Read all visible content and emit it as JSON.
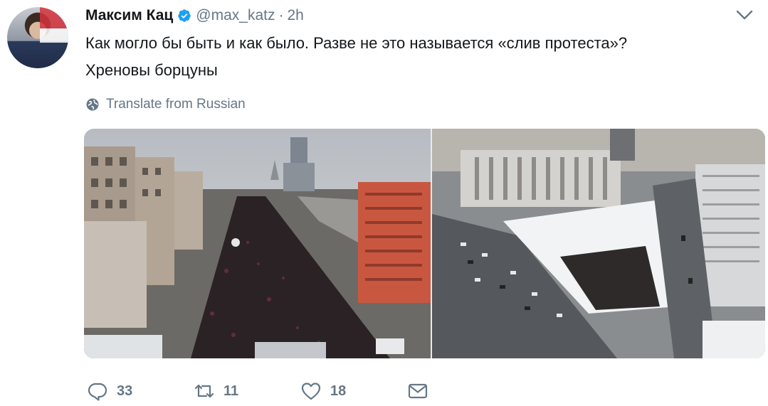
{
  "tweet": {
    "author_name": "Максим Кац",
    "handle": "@max_katz",
    "separator": "·",
    "time": "2h",
    "text_line_1": "Как могло бы быть и как было. Разве не это называется «слив протеста»?",
    "text_line_2": "Хреновы борцуны",
    "translate_label": "Translate from Russian"
  },
  "actions": {
    "replies": "33",
    "retweets": "11",
    "likes": "18"
  },
  "icons": {
    "verified": "verified-badge-icon",
    "more": "chevron-down-icon",
    "translate": "globe-icon",
    "reply": "reply-icon",
    "retweet": "retweet-icon",
    "like": "heart-icon",
    "message": "envelope-icon"
  },
  "colors": {
    "text": "#14171a",
    "secondary": "#657786",
    "verified": "#1da1f2"
  }
}
